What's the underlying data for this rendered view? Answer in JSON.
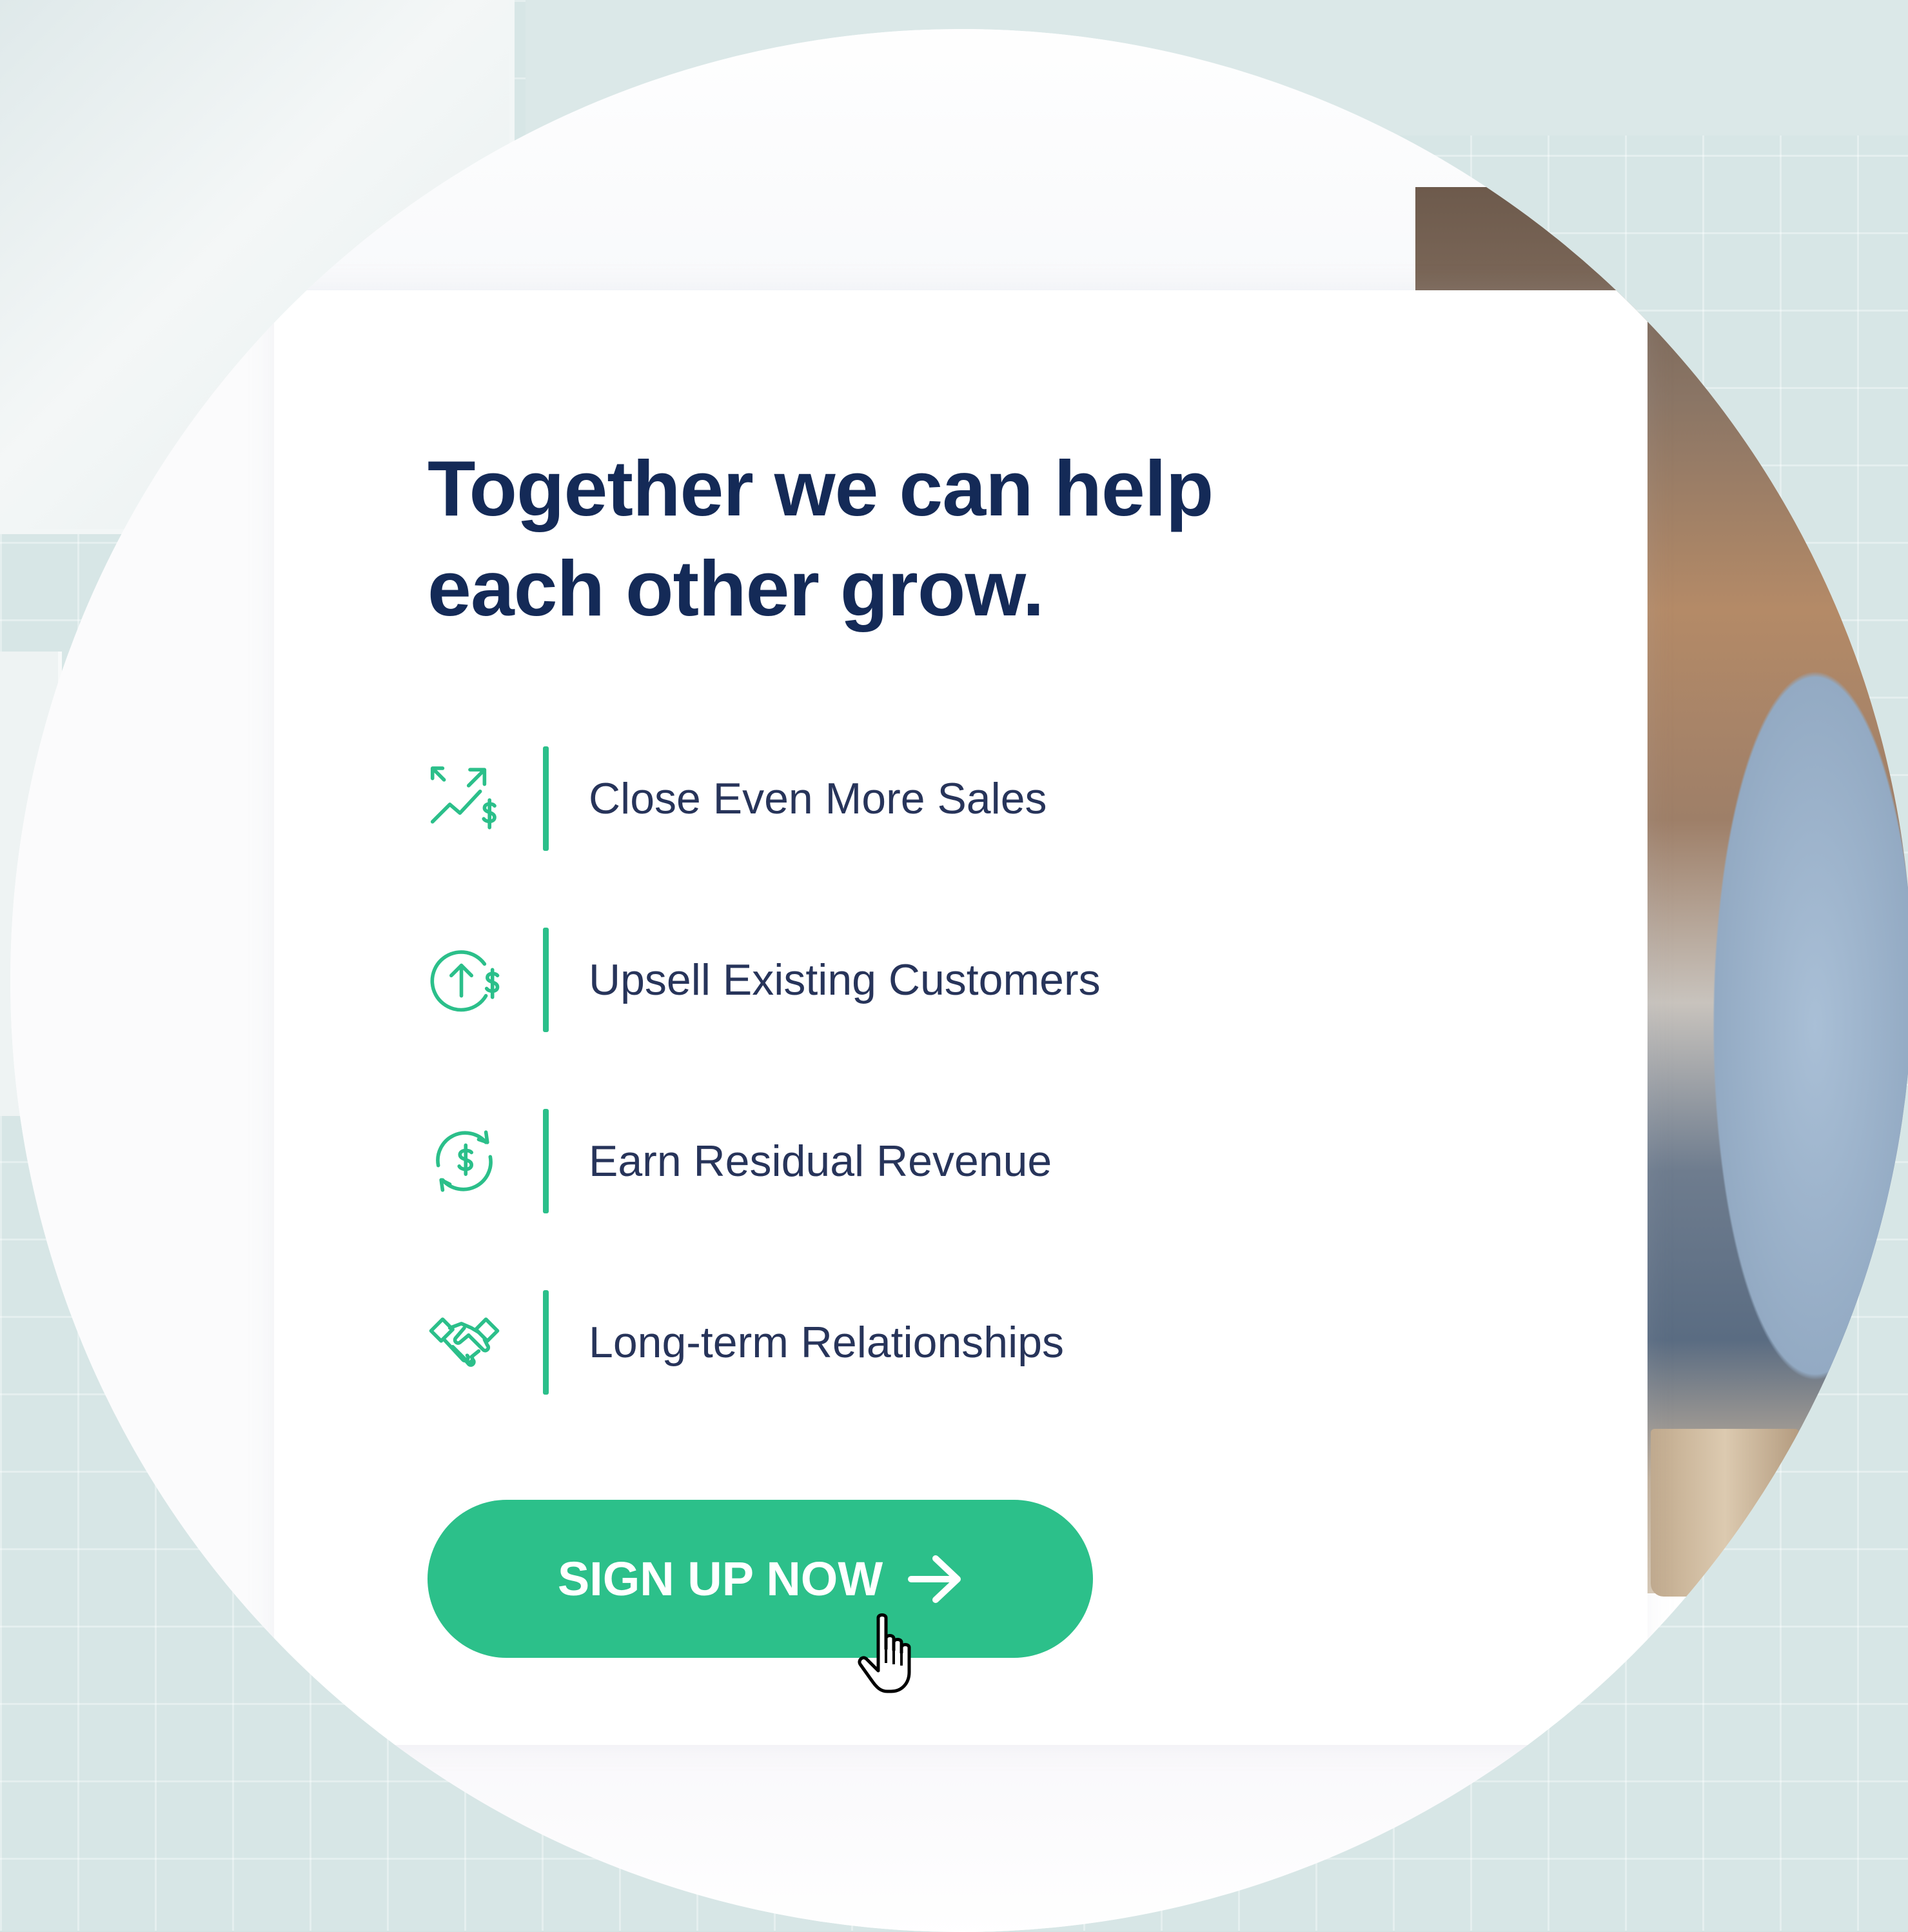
{
  "headline": {
    "line1": "Together we can help",
    "line2": "each other grow."
  },
  "features": [
    {
      "icon": "sales-growth-icon",
      "label": "Close Even More Sales"
    },
    {
      "icon": "upsell-arrow-dollar-icon",
      "label": "Upsell Existing Customers"
    },
    {
      "icon": "recurring-dollar-icon",
      "label": "Earn Residual Revenue"
    },
    {
      "icon": "handshake-icon",
      "label": "Long-term Relationships"
    }
  ],
  "cta": {
    "label": "SIGN UP NOW",
    "icon": "arrow-right-icon"
  },
  "cursor": {
    "icon": "hand-pointer-icon"
  },
  "colors": {
    "accent": "#2cc08a",
    "headline": "#142a57",
    "body_text": "#27345a",
    "card": "#ffffff"
  }
}
